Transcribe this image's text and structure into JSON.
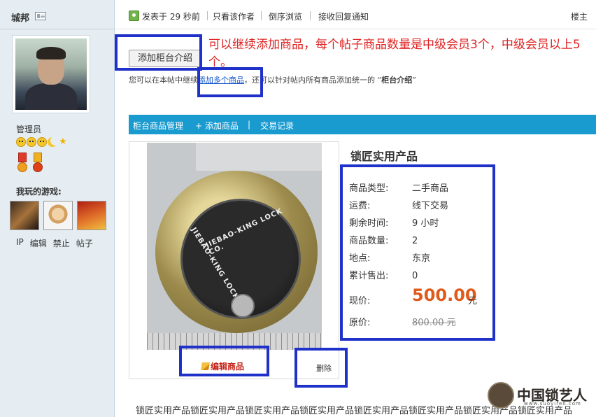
{
  "user": {
    "name": "城邦",
    "role": "管理员",
    "games_title": "我玩的游戏:",
    "links": [
      "IP",
      "编辑",
      "禁止",
      "帖子"
    ]
  },
  "topbar": {
    "posted": "发表于 29 秒前",
    "author_only": "只看该作者",
    "reverse": "倒序浏览",
    "notify": "接收回复通知",
    "floor": "楼主"
  },
  "toolbar": {
    "add_intro_label": "添加柜台介绍"
  },
  "annotation": "可以继续添加商品，每个帖子商品数量是中级会员3个，中级会员以上5个。",
  "hint": {
    "prefix": "您可以在本帖中继续",
    "link": "添加多个商品",
    "middle": "，还可以针对帖内所有商品添加统一的 “",
    "bold": "柜台介绍",
    "suffix": "”"
  },
  "tabs": [
    "柜台商品管理",
    "+ 添加商品",
    "|",
    "交易记录"
  ],
  "product": {
    "title": "锁匠实用产品",
    "image_text": [
      "JIEBAO-KING LOCK CO.",
      "JIEBAO-KING LOCK CO."
    ],
    "rows": [
      {
        "label": "商品类型:",
        "value": "二手商品"
      },
      {
        "label": "运费:",
        "value": "线下交易"
      },
      {
        "label": "剩余时间:",
        "value": "9 小时"
      },
      {
        "label": "商品数量:",
        "value": "2"
      },
      {
        "label": "地点:",
        "value": "东京"
      },
      {
        "label": "累计售出:",
        "value": "0"
      }
    ],
    "price_label": "现价:",
    "price": "500.00",
    "price_unit": "元",
    "orig_label": "原价:",
    "orig_price": "800.00 元",
    "edit_label": "编辑商品",
    "delete_label": "删除"
  },
  "description": "锁匠实用产品锁匠实用产品锁匠实用产品锁匠实用产品锁匠实用产品锁匠实用产品锁匠实用产品锁匠实用产品",
  "watermark": {
    "text": "中国锁艺人",
    "url": "www.suoyiren.com"
  },
  "colors": {
    "tabbar": "#1a9bd0",
    "highlight_box": "#1f31c8",
    "annotation": "#e02222",
    "price": "#e05a1a"
  }
}
